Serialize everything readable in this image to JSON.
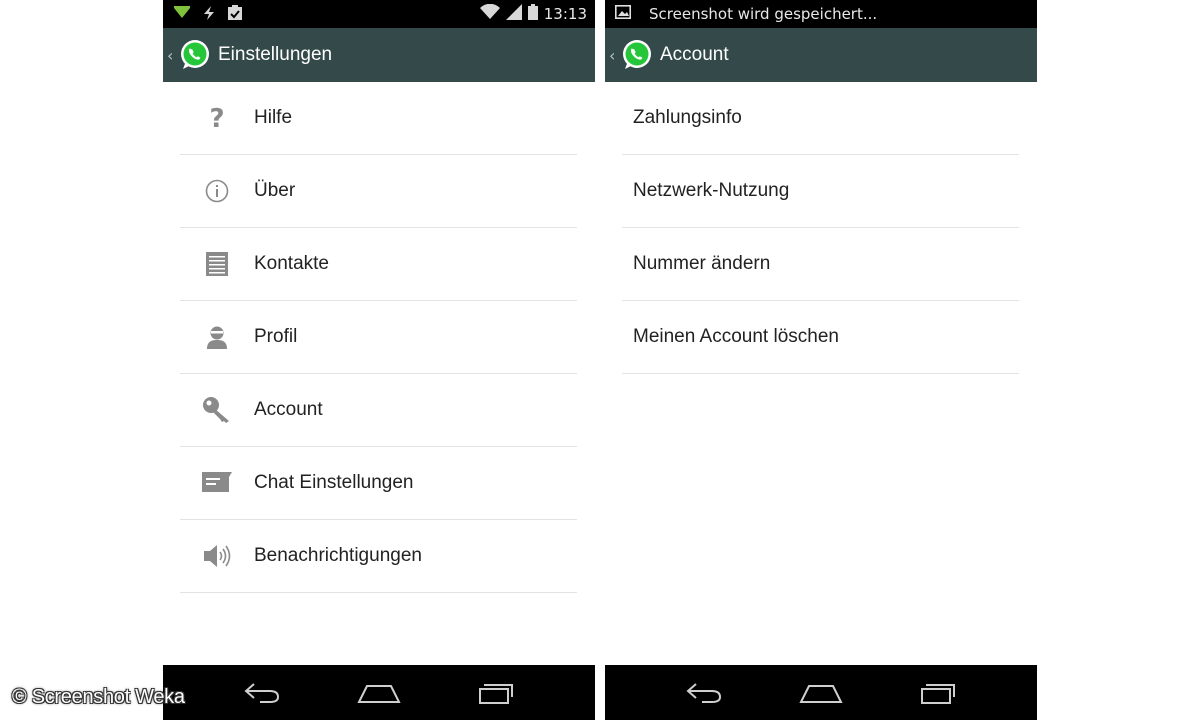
{
  "left_screen": {
    "status": {
      "time": "13:13"
    },
    "title": "Einstellungen",
    "items": [
      {
        "label": "Hilfe",
        "icon": "help-icon"
      },
      {
        "label": "Über",
        "icon": "info-icon"
      },
      {
        "label": "Kontakte",
        "icon": "contacts-icon"
      },
      {
        "label": "Profil",
        "icon": "profile-icon"
      },
      {
        "label": "Account",
        "icon": "key-icon"
      },
      {
        "label": "Chat Einstellungen",
        "icon": "chat-icon"
      },
      {
        "label": "Benachrichtigungen",
        "icon": "speaker-icon"
      }
    ]
  },
  "right_screen": {
    "status": {
      "notification": "Screenshot wird gespeichert..."
    },
    "title": "Account",
    "items": [
      {
        "label": "Zahlungsinfo"
      },
      {
        "label": "Netzwerk-Nutzung"
      },
      {
        "label": "Nummer ändern"
      },
      {
        "label": "Meinen Account löschen"
      }
    ]
  },
  "watermark": "© Screenshot Weka",
  "colors": {
    "action_bar": "#34494a",
    "whatsapp_green": "#25c63a",
    "icon_gray": "#8a8a8a"
  }
}
